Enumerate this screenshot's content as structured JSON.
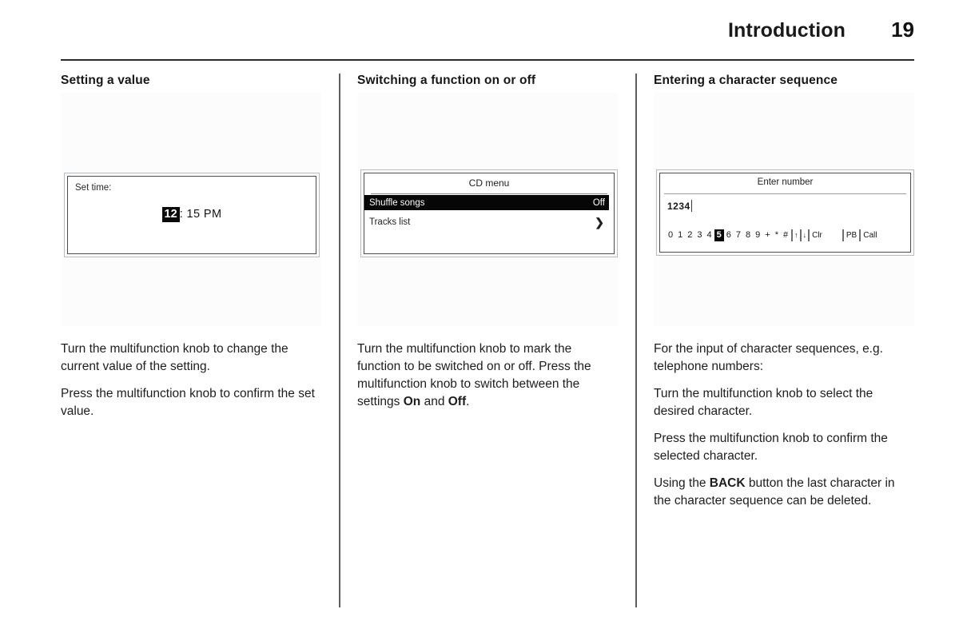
{
  "header": {
    "title": "Introduction",
    "page_number": "19"
  },
  "columns": [
    {
      "heading": "Setting a value",
      "display": {
        "kind": "set-time",
        "label": "Set time:",
        "selected_value": "12",
        "rest_value": ": 15 PM"
      },
      "paragraphs": [
        "Turn the multifunction knob to change the current value of the setting.",
        "Press the multifunction knob to confirm the set value."
      ]
    },
    {
      "heading": "Switching a function on or off",
      "display": {
        "kind": "cd-menu",
        "title": "CD menu",
        "rows": [
          {
            "label": "Shuffle songs",
            "value": "Off",
            "selected": true
          },
          {
            "label": "Tracks list",
            "value": "❯",
            "selected": false
          }
        ]
      },
      "paragraphs": [
        "Turn the multifunction knob to mark the function to be switched on or off. Press the multifunction knob to switch between the settings On and Off."
      ],
      "paragraph_parts": {
        "p1_a": "Turn the multifunction knob to mark the function to be switched on or off. Press the multifunction knob to switch between the settings ",
        "p1_bold1": "On",
        "p1_b": " and ",
        "p1_bold2": "Off",
        "p1_c": "."
      }
    },
    {
      "heading": "Entering a character sequence",
      "display": {
        "kind": "enter-number",
        "title": "Enter number",
        "value": "1234",
        "keys": [
          "0",
          "1",
          "2",
          "3",
          "4",
          "5",
          "6",
          "7",
          "8",
          "9",
          "+",
          "*",
          "#"
        ],
        "selected_key": "5",
        "arrow_glyphs": [
          "↑",
          "↓"
        ],
        "buttons": [
          "Clr",
          "PB",
          "Call"
        ]
      },
      "paragraphs": [
        "For the input of character sequences, e.g. telephone numbers:",
        "Turn the multifunction knob to select the desired character.",
        "Press the multifunction knob to confirm the selected character.",
        "Using the BACK button the last character in the character sequence can be deleted."
      ],
      "paragraph_parts": {
        "p4_a": "Using the ",
        "p4_bold": "BACK",
        "p4_b": " button the last character in the character sequence can be deleted."
      }
    }
  ],
  "colors": {
    "rule": "#2b2b2b",
    "divider": "#5c6063",
    "highlight_bg": "#060606",
    "highlight_fg": "#ffffff",
    "screen_border": "#4a4d50"
  }
}
